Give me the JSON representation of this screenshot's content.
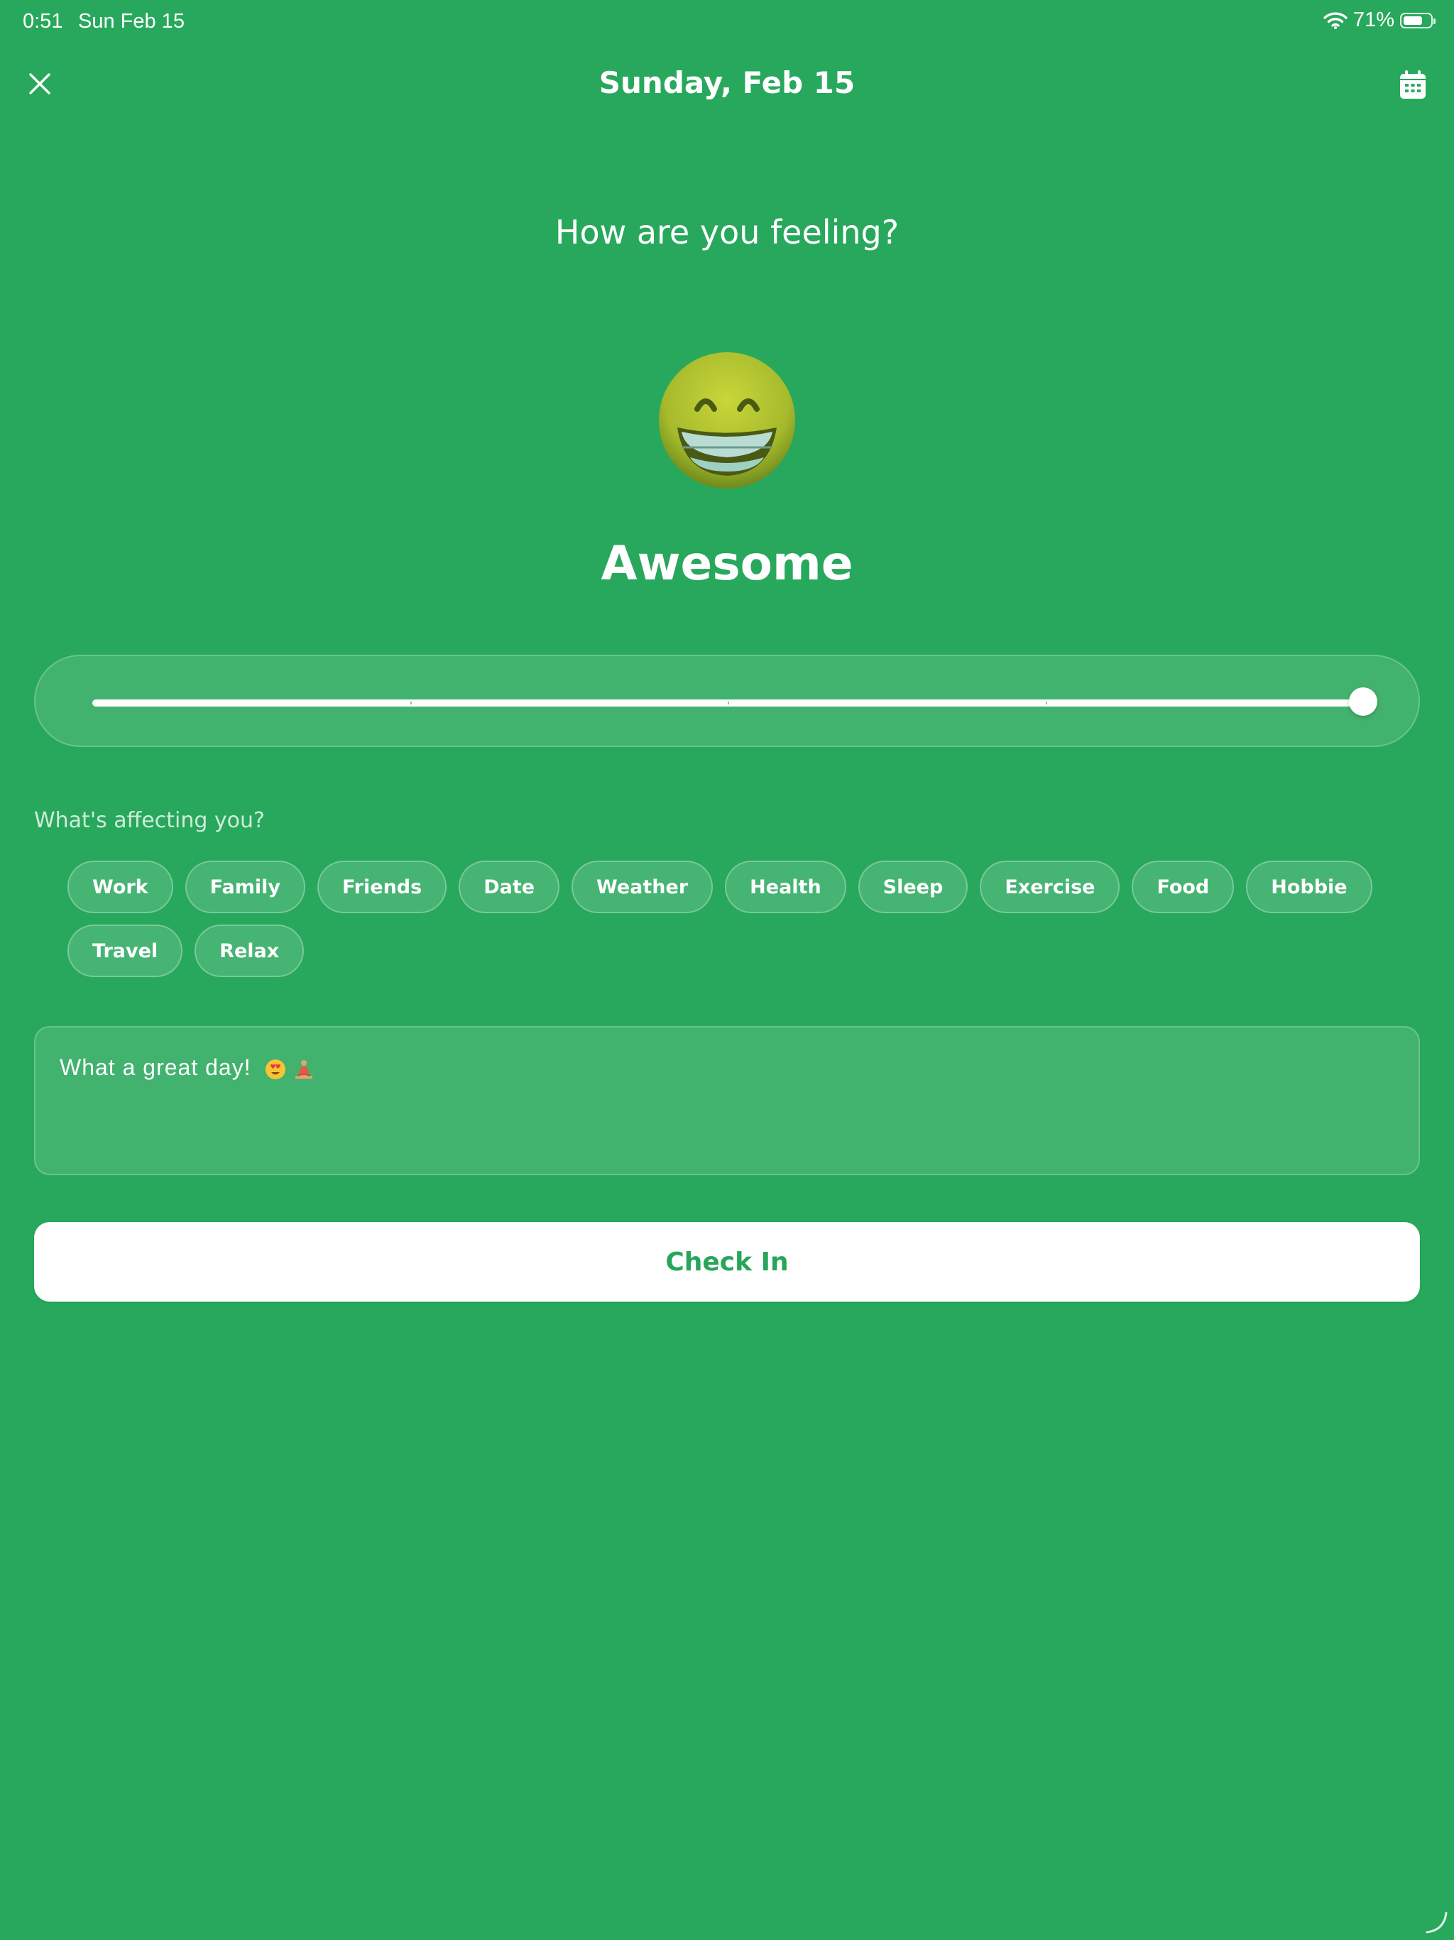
{
  "status_bar": {
    "time": "0:51",
    "date": "Sun Feb 15",
    "battery_text": "71%",
    "battery_level": 0.71
  },
  "header": {
    "title": "Sunday, Feb 15",
    "close_icon": "close-icon",
    "calendar_icon": "calendar-icon"
  },
  "mood": {
    "prompt": "How are you feeling?",
    "emoji_icon": "grinning-face-emoji",
    "label": "Awesome",
    "slider_value": 1.0,
    "slider_steps": 5
  },
  "factors": {
    "label": "What's affecting you?",
    "tags": [
      "Work",
      "Family",
      "Friends",
      "Date",
      "Weather",
      "Health",
      "Sleep",
      "Exercise",
      "Food",
      "Hobbie",
      "Travel",
      "Relax"
    ]
  },
  "note": {
    "text": "What a great day!",
    "emoji_icons": [
      "heart-eyes-emoji",
      "meditation-emoji"
    ]
  },
  "actions": {
    "checkin_label": "Check In"
  },
  "colors": {
    "background": "#28a85c",
    "accent": "#27a65b"
  }
}
